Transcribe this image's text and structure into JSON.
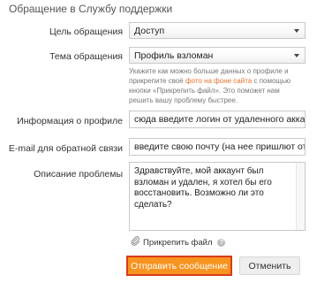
{
  "form": {
    "title": "Обращение в Службу поддержки",
    "reason": {
      "label": "Цель обращения",
      "value": "Доступ"
    },
    "topic": {
      "label": "Тема обращения",
      "value": "Профиль взломан"
    },
    "hint": {
      "part1": "Укажите как можно больше данных о профиле и прикрепите своё ",
      "link": "фото на фоне сайта",
      "part2": " с помощью кнопки «Прикрепить файл». Это поможет нам решить вашу проблему быстрее."
    },
    "profile": {
      "label": "Информация о профиле",
      "value": "сюда введите логин от удаленного аккаунта"
    },
    "email": {
      "label": "E-mail для обратной связи",
      "value": "введите свою почту (на нее пришлют ответ)"
    },
    "description": {
      "label": "Описание проблемы",
      "value": "Здравствуйте, мой аккаунт был взломан и удален, я хотел бы его восстановить. Возможно ли это сделать?"
    },
    "attach_label": "Прикрепить файл",
    "help_glyph": "?",
    "submit_label": "Отправить сообщение",
    "cancel_label": "Отменить"
  },
  "colors": {
    "accent": "#f7931e",
    "submit_border": "#d83b1b",
    "link": "#eb722e"
  }
}
